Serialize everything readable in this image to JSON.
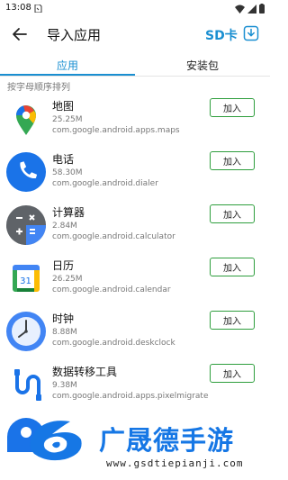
{
  "status_bar": {
    "time": "13:08"
  },
  "header": {
    "title": "导入应用",
    "sd_label": "SD卡"
  },
  "tabs": [
    {
      "label": "应用",
      "active": true
    },
    {
      "label": "安装包",
      "active": false
    }
  ],
  "sort_label": "按字母顺序排列",
  "apps": [
    {
      "name": "地图",
      "size": "25.25M",
      "package": "com.google.android.apps.maps",
      "button": "加入",
      "icon": "maps-icon"
    },
    {
      "name": "电话",
      "size": "58.30M",
      "package": "com.google.android.dialer",
      "button": "加入",
      "icon": "phone-icon"
    },
    {
      "name": "计算器",
      "size": "2.84M",
      "package": "com.google.android.calculator",
      "button": "加入",
      "icon": "calculator-icon"
    },
    {
      "name": "日历",
      "size": "26.25M",
      "package": "com.google.android.calendar",
      "button": "加入",
      "icon": "calendar-icon"
    },
    {
      "name": "时钟",
      "size": "8.88M",
      "package": "com.google.android.deskclock",
      "button": "加入",
      "icon": "clock-icon"
    },
    {
      "name": "数据转移工具",
      "size": "9.38M",
      "package": "com.google.android.apps.pixelmigrate",
      "button": "加入",
      "icon": "data-transfer-icon"
    }
  ],
  "calendar_day": "31",
  "watermark": {
    "text": "广晟德手游",
    "url": "www.gsdtiepianji.com"
  },
  "colors": {
    "accent": "#1a8fd1",
    "button_border": "#2e9e3d",
    "watermark": "#1677e5"
  }
}
